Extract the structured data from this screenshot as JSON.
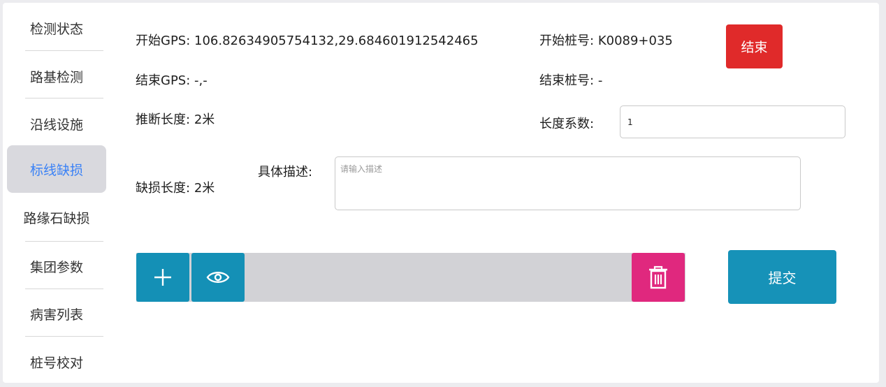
{
  "sidebar": {
    "items": [
      {
        "label": "检测状态",
        "active": false
      },
      {
        "label": "路基检测",
        "active": false
      },
      {
        "label": "沿线设施",
        "active": false
      },
      {
        "label": "标线缺损",
        "active": true
      },
      {
        "label": "路缘石缺损",
        "active": false
      },
      {
        "label": "集团参数",
        "active": false
      },
      {
        "label": "病害列表",
        "active": false
      },
      {
        "label": "桩号校对",
        "active": false
      }
    ]
  },
  "form": {
    "start_gps_label": "开始GPS:",
    "start_gps_value": "106.82634905754132,29.684601912542465",
    "start_stake_label": "开始桩号:",
    "start_stake_value": "K0089+035",
    "end_gps_label": "结束GPS:",
    "end_gps_value": "-,-",
    "end_stake_label": "结束桩号:",
    "end_stake_value": "-",
    "inferred_length_label": "推断长度:",
    "inferred_length_value": "2米",
    "length_factor_label": "长度系数:",
    "length_factor_value": "1",
    "defect_length_label": "缺损长度:",
    "defect_length_value": "2米",
    "description_label": "具体描述:",
    "description_placeholder": "请输入描述",
    "end_button": "结束",
    "submit_button": "提交"
  },
  "colors": {
    "end_button": "#e02a2a",
    "tool_button": "#1490b6",
    "delete_button": "#e0287e",
    "active_sidebar_text": "#3b82f6"
  },
  "icons": {
    "add": "plus-icon",
    "view": "eye-icon",
    "delete": "trash-icon"
  }
}
